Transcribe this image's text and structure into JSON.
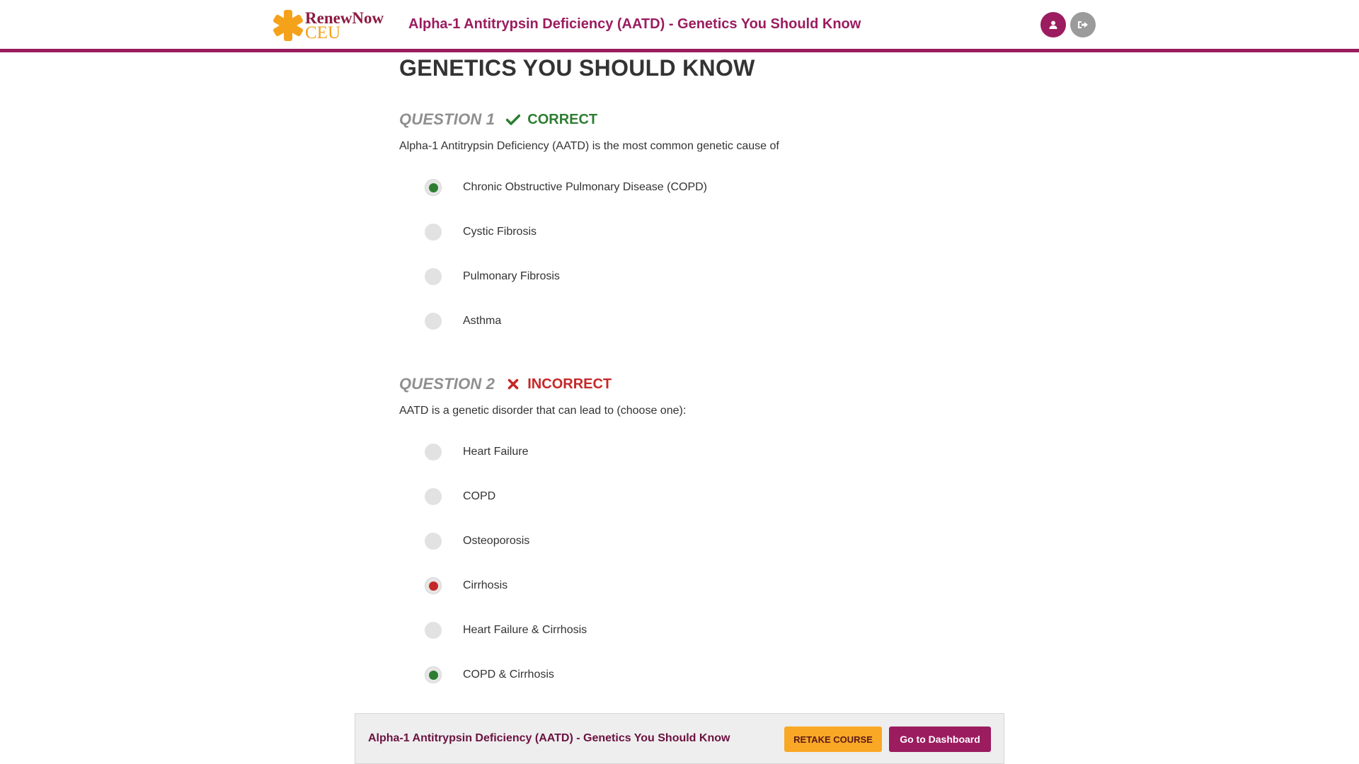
{
  "header": {
    "logo_top": "RenewNow",
    "logo_bottom": "CEU",
    "title": "Alpha-1 Antitrypsin Deficiency (AATD) - Genetics You Should Know",
    "user_icon": "user-icon",
    "logout_icon": "sign-out-icon"
  },
  "page": {
    "title": "GENETICS YOU SHOULD KNOW"
  },
  "questions": [
    {
      "label": "QUESTION 1",
      "status": "CORRECT",
      "status_icon": "checkmark-icon",
      "text": "Alpha-1 Antitrypsin Deficiency (AATD) is the most common genetic cause of",
      "options": [
        {
          "label": "Chronic Obstructive Pulmonary Disease (COPD)",
          "state": "selected-correct"
        },
        {
          "label": "Cystic Fibrosis",
          "state": "unselected"
        },
        {
          "label": "Pulmonary Fibrosis",
          "state": "unselected"
        },
        {
          "label": "Asthma",
          "state": "unselected"
        }
      ]
    },
    {
      "label": "QUESTION 2",
      "status": "INCORRECT",
      "status_icon": "x-icon",
      "text": "AATD is a genetic disorder that can lead to (choose one):",
      "options": [
        {
          "label": "Heart Failure",
          "state": "unselected"
        },
        {
          "label": "COPD",
          "state": "unselected"
        },
        {
          "label": "Osteoporosis",
          "state": "unselected"
        },
        {
          "label": "Cirrhosis",
          "state": "selected-wrong"
        },
        {
          "label": "Heart Failure & Cirrhosis",
          "state": "unselected"
        },
        {
          "label": "COPD & Cirrhosis",
          "state": "correct-answer"
        }
      ]
    }
  ],
  "footer": {
    "title": "Alpha-1 Antitrypsin Deficiency (AATD) - Genetics You Should Know",
    "retake_label": "RETAKE COURSE",
    "dashboard_label": "Go to Dashboard"
  },
  "colors": {
    "brand": "#9b1c5f",
    "accent": "#f9a825",
    "correct": "#2e7d32",
    "incorrect": "#c62828"
  }
}
